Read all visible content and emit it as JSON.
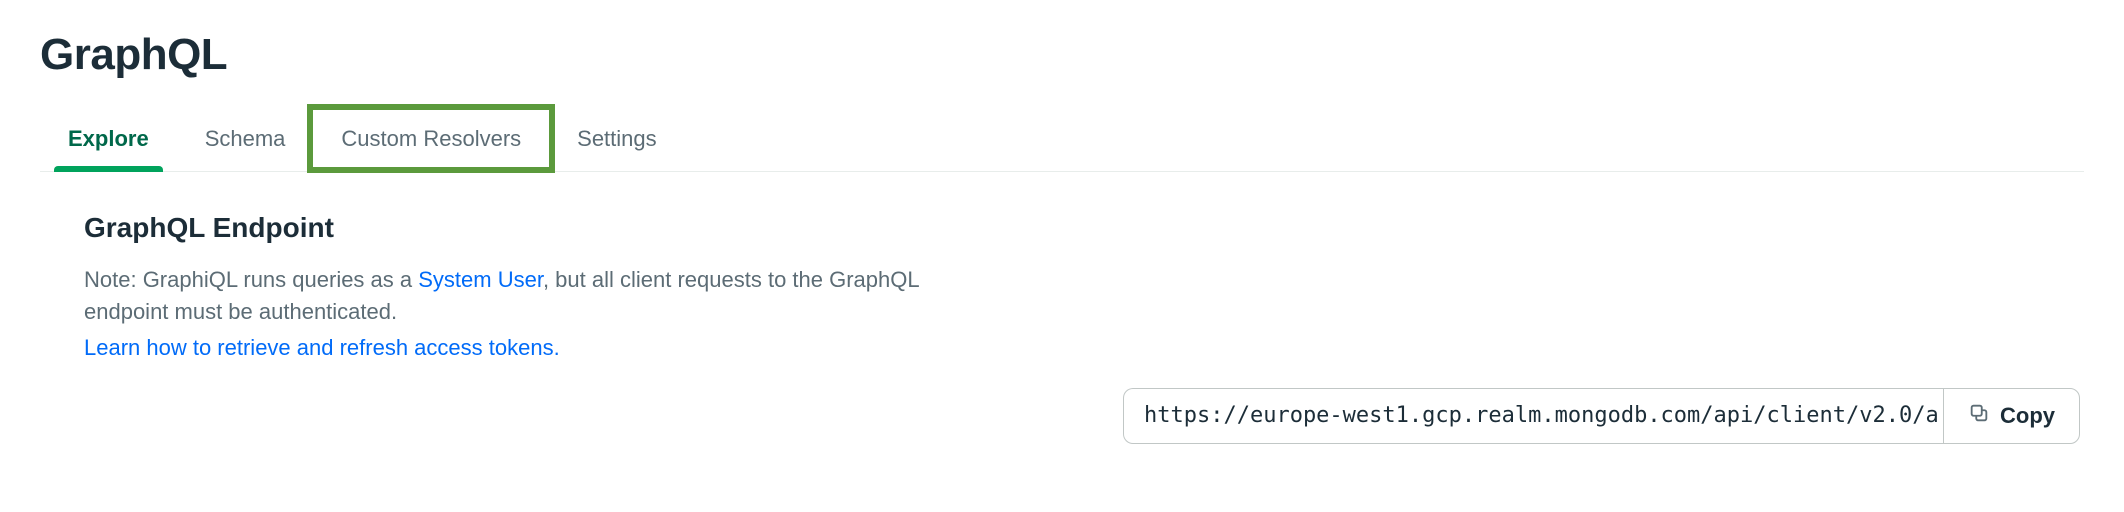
{
  "page_title": "GraphQL",
  "tabs": [
    {
      "label": "Explore",
      "id": "explore",
      "active": true
    },
    {
      "label": "Schema",
      "id": "schema",
      "active": false
    },
    {
      "label": "Custom Resolvers",
      "id": "custom-resolvers",
      "active": false,
      "highlighted": true
    },
    {
      "label": "Settings",
      "id": "settings",
      "active": false
    }
  ],
  "section": {
    "title": "GraphQL Endpoint",
    "note_prefix": "Note: GraphiQL runs queries as a ",
    "note_link_system_user": "System User",
    "note_suffix": ", but all client requests to the GraphQL endpoint must be authenticated.",
    "learn_link": "Learn how to retrieve and refresh access tokens."
  },
  "endpoint": {
    "url": "https://europe-west1.gcp.realm.mongodb.com/api/client/v2.0/a",
    "copy_label": "Copy"
  }
}
